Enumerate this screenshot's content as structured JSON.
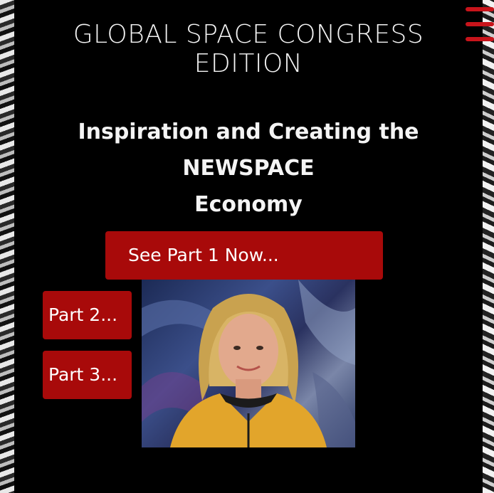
{
  "header": {
    "title_line1": "GLOBAL SPACE CONGRESS",
    "title_line2": "EDITION",
    "subtitle_line1": "Inspiration and Creating the NEWSPACE",
    "subtitle_line2": "Economy"
  },
  "buttons": {
    "part1_label": "See Part 1 Now...",
    "part2_label": "Part 2...",
    "part3_label": "Part 3..."
  },
  "icons": {
    "menu": "hamburger-menu-icon"
  },
  "colors": {
    "background": "#000000",
    "button": "#a80a0a",
    "menu_accent": "#c8141b",
    "text": "#f4f4f4"
  }
}
